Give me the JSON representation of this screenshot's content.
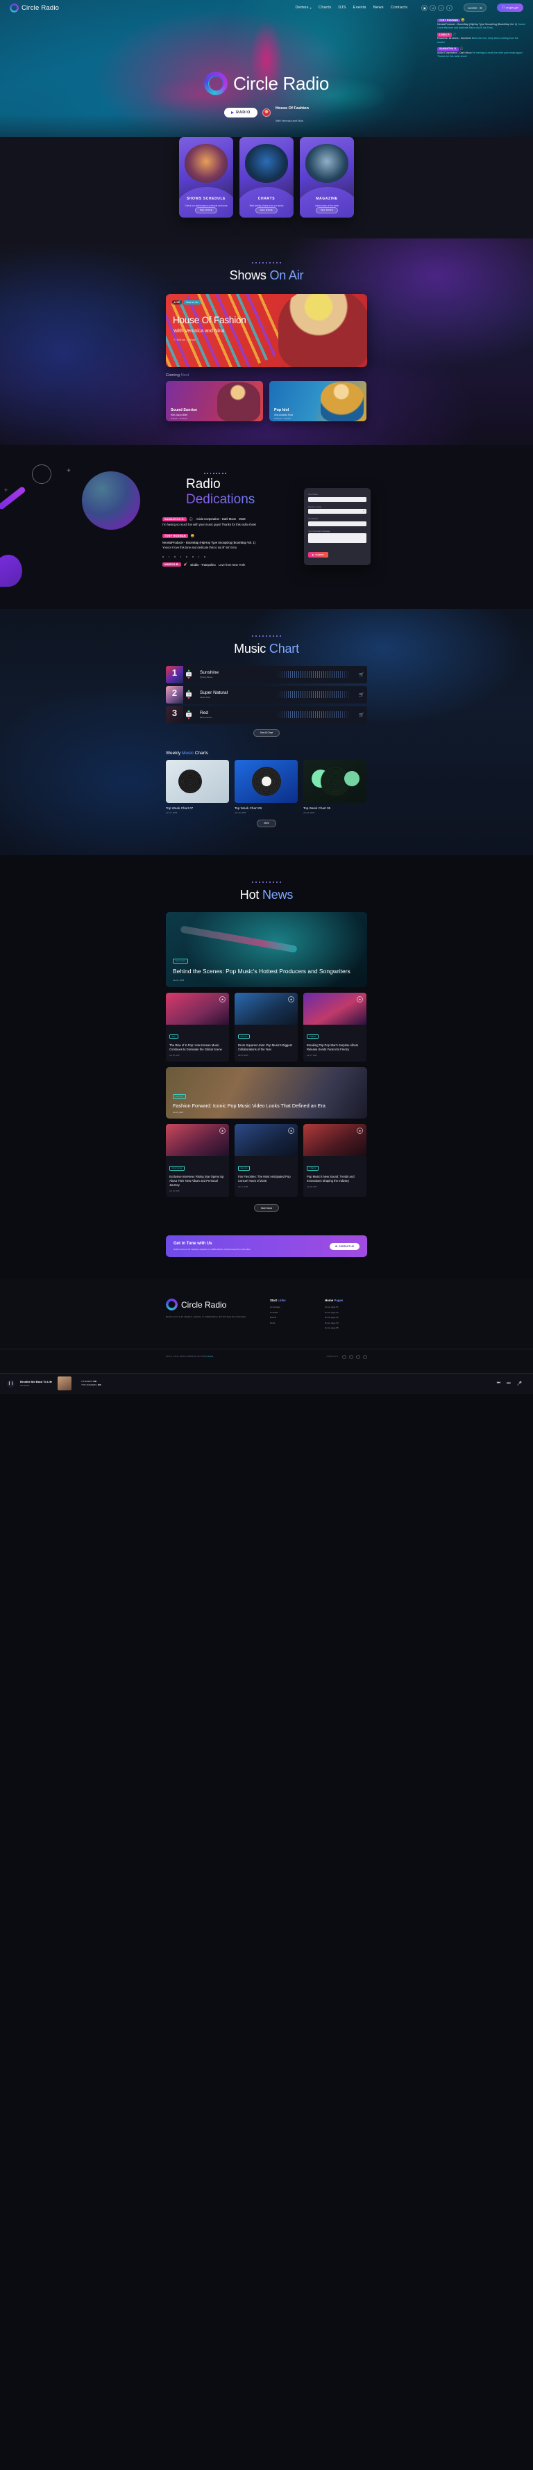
{
  "brand": {
    "name": "Circle Radio"
  },
  "nav": {
    "links": [
      {
        "label": "Demos",
        "has_caret": true
      },
      {
        "label": "Charts",
        "has_caret": false
      },
      {
        "label": "DJS",
        "has_caret": false
      },
      {
        "label": "Events",
        "has_caret": false
      },
      {
        "label": "News",
        "has_caret": false
      },
      {
        "label": "Contacts",
        "has_caret": false
      }
    ],
    "socials": [
      "instagram-icon",
      "spotify-icon",
      "tiktok-icon",
      "facebook-icon"
    ],
    "more_label": "MORE",
    "popup_label": "POPUP"
  },
  "hero": {
    "title": "Circle Radio",
    "radio_button": "RADIO",
    "now_playing_title": "House Of Fashion",
    "now_playing_sub": "With Veronica and Nina",
    "chat": [
      {
        "name": "TONY RODMAN",
        "emoji": "😃",
        "song": "NeostaProducer - BoomBap (HipHop Type SnoopDog (BoomBap Vol. 1)",
        "text": "Yoooo! I love this tune and dedicate this to my lil' sis' Ema"
      },
      {
        "name": "LINDA P.",
        "emoji": "🎵",
        "song": "Rockfeller Brothers - Sunshine",
        "text": "Best mix ever, keep them coming from the studio!"
      },
      {
        "name": "SAMANTHA G.",
        "emoji": "🎧",
        "song": "Acida Corporation - Dark Moon",
        "text": "I'm having so much fun with your music guys! Thanks for this radio show!"
      }
    ]
  },
  "promo_cards": [
    {
      "title": "SHOWS SCHEDULE",
      "subtitle": "Check our performance schedule and more",
      "button": "SEE MORE"
    },
    {
      "title": "CHARTS",
      "subtitle": "Best weekly charts from our studio",
      "button": "SEE MORE"
    },
    {
      "title": "MAGAZINE",
      "subtitle": "Latest news of the week",
      "button": "SEE MORE"
    }
  ],
  "shows": {
    "heading_plain": "Shows ",
    "heading_accent": "On Air",
    "on_air": {
      "badge_live": "LIVE",
      "badge_text": "Now on air",
      "title": "House Of Fashion",
      "subtitle": "With Veronica and Nina",
      "time": "6:00 pm - 9:30 pm"
    },
    "coming_plain": "Coming ",
    "coming_accent": "Next",
    "next": [
      {
        "title": "Sound Sunrise",
        "subtitle": "With Jason Miller",
        "time": "9:30 pm - 11:00 pm"
      },
      {
        "title": "Pop Idol",
        "subtitle": "With Amanda Rose",
        "time": "11:00 pm - 1:00 am"
      }
    ]
  },
  "dedications": {
    "heading_1": "Radio",
    "heading_2": "Dedications",
    "items": [
      {
        "name": "SAMANTHA G.",
        "emoji": "🎧",
        "song": "Acida Corporation - Dark Moon",
        "note": "2028",
        "text": "I'm having so much fun with your music guys! Thanks for this radio show!"
      },
      {
        "name": "TONY RODMAN",
        "emoji": "😃",
        "song": "NeostaProducer - BoomBap (HipHop Type SnoopDog (BoomBap Vol. 1)",
        "text": "Yoooo! I love this tune and dedicate this to my lil' sis' Ema"
      },
      {
        "name": "MARCO B.",
        "emoji": "🎸",
        "song": "Diablo - Trampolino",
        "text": "Love from New York!"
      }
    ],
    "form": {
      "name_label": "Your Name",
      "song_label": "Choose a song",
      "email_label": "Your Email",
      "message_label": "Your Dedication Message",
      "submit_label": "SUBMIT"
    }
  },
  "music_chart": {
    "heading_plain": "Music ",
    "heading_accent": "Chart",
    "see_all_label": "See All Chart",
    "rows": [
      {
        "rank": "1",
        "position": "4",
        "title": "Sunshine",
        "artist": "Tommy Bruce"
      },
      {
        "rank": "2",
        "position": "4",
        "title": "Super Natural",
        "artist": "Jamie Teck"
      },
      {
        "rank": "3",
        "position": "2",
        "title": "Red",
        "artist": "Elisa Garden"
      }
    ],
    "weekly_heading_1": "Weekly ",
    "weekly_heading_accent": "Music",
    "weekly_heading_2": " Charts",
    "weekly": [
      {
        "title": "Top Week Chart 07",
        "date": "Jan 17, 2025"
      },
      {
        "title": "Top Week Chart 06",
        "date": "Jan 10, 2025"
      },
      {
        "title": "Top Week Chart 05",
        "date": "Jan 03, 2025"
      }
    ],
    "more_label": "More"
  },
  "news": {
    "heading_plain": "Hot ",
    "heading_accent": "News",
    "featured": {
      "tag": "Interviews",
      "title": "Behind the Scenes: Pop Music's Hottest Producers and Songwriters",
      "date": "Jan 21, 2025"
    },
    "row1": [
      {
        "tag": "Pop",
        "title": "The Rise of K-Pop: How Korean Music Continues to Dominate the Global Scene",
        "date": "Jan 19, 2025"
      },
      {
        "tag": "Events",
        "title": "Drum Squares Unite: Pop Music's Biggest Collaborations of the Year",
        "date": "Jan 18, 2025"
      },
      {
        "tag": "Charts",
        "title": "Breaking Top Pop Star's Surprise Album Release Sends Fans Into Frenzy",
        "date": "Jan 17, 2025"
      }
    ],
    "wide": {
      "tag": "Fashion",
      "title": "Fashion Forward: Iconic Pop Music Video Looks That Defined an Era",
      "date": "Jan 15, 2025"
    },
    "row2": [
      {
        "tag": "Interviews",
        "title": "Exclusive Interview: Rising Star Opens Up About Their New Album and Personal Journey",
        "date": "Jan 13, 2025"
      },
      {
        "tag": "Events",
        "title": "Fan Favorites: The Most Anticipated Pop Concert Tours of 2025",
        "date": "Jan 11, 2025"
      },
      {
        "tag": "Charts",
        "title": "Pop Music's New Sound: Trends and Innovations Shaping the Industry",
        "date": "Jan 09, 2025"
      }
    ],
    "more_label": "More News"
  },
  "cta": {
    "title": "Get in Tune with Us",
    "text": "Reach out to us for inquiries, requests, or collaborations, and let's keep the music alive.",
    "button": "CONTACT US"
  },
  "footer": {
    "brand": "Circle Radio",
    "tagline": "Reach out to us for inquiries, requests, or collaborations, and let's keep the music alive.",
    "col1": {
      "title_plain": "Start ",
      "title_accent": "Links",
      "items": [
        "Homepage",
        "Contacts",
        "Events",
        "News"
      ]
    },
    "col2": {
      "title_plain": "Home ",
      "title_accent": "Pages",
      "items": [
        "Home page 01",
        "Home page 02",
        "Home page 03",
        "Home page 04",
        "Home page 05"
      ]
    },
    "bottom_left": "BUILD YOUR RADIO WEBSITE WITH ",
    "bottom_left_accent": "Pro Radio",
    "bottom_right": "CONTACTS"
  },
  "player": {
    "track_title": "Breathe Me Back To Life",
    "track_artist": "Stonebank",
    "listeners_label": "LISTENERS:",
    "listeners_value": "248",
    "top_listeners_label": "TOP LISTENERS:",
    "top_listeners_value": "400",
    "controls": [
      "prev-icon",
      "next-icon",
      "mic-icon"
    ]
  }
}
